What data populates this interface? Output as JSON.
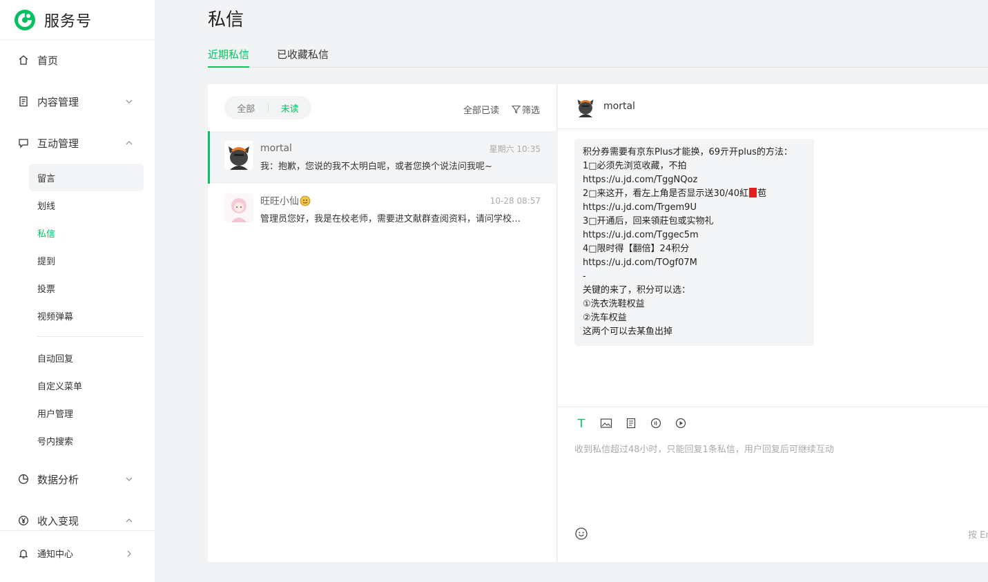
{
  "app": {
    "name": "服务号",
    "brand_color": "#07c160"
  },
  "sidebar": {
    "home": "首页",
    "content_mgmt": "内容管理",
    "interact_mgmt": "互动管理",
    "interact_items": [
      "留言",
      "划线",
      "私信",
      "提到",
      "投票",
      "视频弹幕"
    ],
    "other_items": [
      "自动回复",
      "自定义菜单",
      "用户管理",
      "号内搜索"
    ],
    "data_analysis": "数据分析",
    "monetize": "收入变现",
    "notify": "通知中心",
    "active_item": "私信",
    "selected_item": "留言"
  },
  "main": {
    "title": "私信",
    "tabs": [
      "近期私信",
      "已收藏私信"
    ],
    "active_tab": "近期私信"
  },
  "list": {
    "filter_all": "全部",
    "filter_unread": "未读",
    "mark_all_read": "全部已读",
    "filter_label": "筛选",
    "conversations": [
      {
        "name": "mortal",
        "time": "星期六 10:35",
        "preview": "我：抱歉，您说的我不太明白呢，或者您换个说法问我呢~",
        "selected": true
      },
      {
        "name": "旺旺小仙",
        "time": "10-28 08:57",
        "preview": "管理员您好，我是在校老师，需要进文献群查阅资料，请问学校…",
        "selected": false
      }
    ]
  },
  "chat": {
    "name": "mortal",
    "message_lines": [
      "积分券需要有京东Plus才能换，69亓开plus的方法：",
      "1\u0000必须先浏览收藏，不拍",
      "https://u.jd.com/TggNQoz",
      "2\u0000来这开，看左上角是否显示送30/40紅",
      "https://u.jd.com/Trgem9U",
      "3\u0000开通后，回来領莊包或实物礼",
      "https://u.jd.com/Tggec5m",
      "4\u0000限时得【翻倍】24积分",
      "https://u.jd.com/TOgf07M",
      "-",
      "关键的来了，积分可以选：",
      "①洗衣洗鞋权益",
      "②洗车权益",
      "这两个可以去某鱼出掉"
    ],
    "composer_placeholder": "收到私信超过48小时，只能回复1条私信，用户回复后可继续互动",
    "send_hint": "按 Enter 发送"
  }
}
